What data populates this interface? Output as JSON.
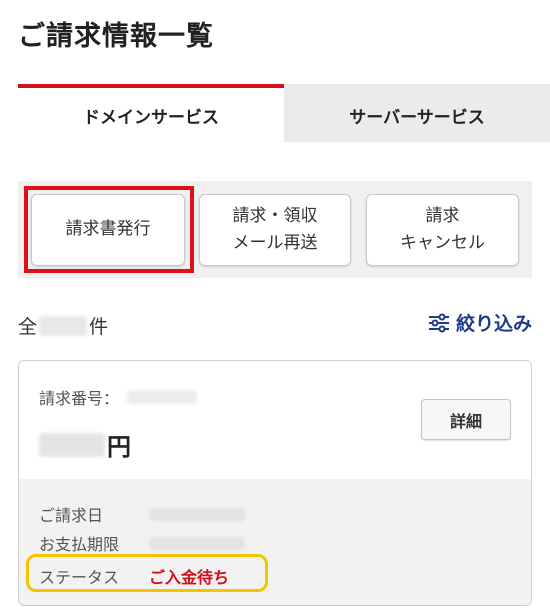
{
  "page": {
    "title": "ご請求情報一覧"
  },
  "tabs": [
    {
      "label": "ドメインサービス",
      "active": true
    },
    {
      "label": "サーバーサービス",
      "active": false
    }
  ],
  "actions": {
    "issue_invoice": "請求書発行",
    "resend_line1": "請求・領収",
    "resend_line2": "メール再送",
    "cancel_line1": "請求",
    "cancel_line2": "キャンセル"
  },
  "summary": {
    "count_prefix": "全",
    "count_suffix": "件",
    "filter_label": "絞り込み"
  },
  "invoice": {
    "number_label": "請求番号：",
    "amount_currency": "円",
    "detail_button": "詳細",
    "billing_date_label": "ご請求日",
    "payment_deadline_label": "お支払期限",
    "status_label": "ステータス",
    "status_value": "ご入金待ち"
  },
  "colors": {
    "accent_red": "#d0101a",
    "link_blue": "#1f3a8a",
    "highlight_yellow": "#f4c400"
  },
  "icons": {
    "filter": "sliders-icon"
  }
}
